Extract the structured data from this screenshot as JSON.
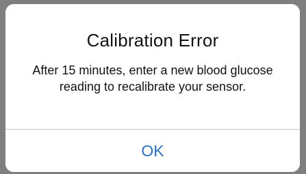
{
  "alert": {
    "title": "Calibration Error",
    "message": "After 15 minutes, enter a new blood glucose reading to recalibrate your sensor.",
    "button_label": "OK"
  },
  "colors": {
    "accent": "#2b6fcd",
    "backdrop": "#7f7f7f",
    "surface": "#ffffff",
    "divider": "#c8c8cc"
  }
}
